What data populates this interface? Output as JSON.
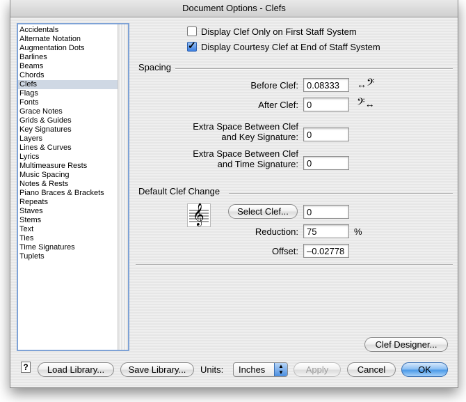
{
  "window": {
    "title": "Document Options - Clefs"
  },
  "sidebar": {
    "items": [
      {
        "label": "Accidentals",
        "selected": false
      },
      {
        "label": "Alternate Notation",
        "selected": false
      },
      {
        "label": "Augmentation Dots",
        "selected": false
      },
      {
        "label": "Barlines",
        "selected": false
      },
      {
        "label": "Beams",
        "selected": false
      },
      {
        "label": "Chords",
        "selected": false
      },
      {
        "label": "Clefs",
        "selected": true
      },
      {
        "label": "Flags",
        "selected": false
      },
      {
        "label": "Fonts",
        "selected": false
      },
      {
        "label": "Grace Notes",
        "selected": false
      },
      {
        "label": "Grids & Guides",
        "selected": false
      },
      {
        "label": "Key Signatures",
        "selected": false
      },
      {
        "label": "Layers",
        "selected": false
      },
      {
        "label": "Lines & Curves",
        "selected": false
      },
      {
        "label": "Lyrics",
        "selected": false
      },
      {
        "label": "Multimeasure Rests",
        "selected": false
      },
      {
        "label": "Music Spacing",
        "selected": false
      },
      {
        "label": "Notes & Rests",
        "selected": false
      },
      {
        "label": "Piano Braces & Brackets",
        "selected": false
      },
      {
        "label": "Repeats",
        "selected": false
      },
      {
        "label": "Staves",
        "selected": false
      },
      {
        "label": "Stems",
        "selected": false
      },
      {
        "label": "Text",
        "selected": false
      },
      {
        "label": "Ties",
        "selected": false
      },
      {
        "label": "Time Signatures",
        "selected": false
      },
      {
        "label": "Tuplets",
        "selected": false
      }
    ]
  },
  "options": {
    "clef_first_only": {
      "label": "Display Clef Only on First Staff System",
      "checked": false
    },
    "courtesy_clef": {
      "label": "Display Courtesy Clef at End of Staff System",
      "checked": true
    }
  },
  "spacing": {
    "heading": "Spacing",
    "before_clef_label": "Before Clef:",
    "before_clef_value": "0.08333",
    "after_clef_label": "After Clef:",
    "after_clef_value": "0",
    "key_sig_label_1": "Extra Space Between Clef",
    "key_sig_label_2": "and Key Signature:",
    "key_sig_value": "0",
    "time_sig_label_1": "Extra Space Between Clef",
    "time_sig_label_2": "and Time Signature:",
    "time_sig_value": "0"
  },
  "default_clef": {
    "heading": "Default Clef Change",
    "select_clef_label": "Select Clef...",
    "clef_value": "0",
    "reduction_label": "Reduction:",
    "reduction_value": "75",
    "reduction_unit": "%",
    "offset_label": "Offset:",
    "offset_value": "–0.02778"
  },
  "buttons": {
    "clef_designer": "Clef Designer...",
    "help": "?",
    "load_library": "Load Library...",
    "save_library": "Save Library...",
    "units_label": "Units:",
    "units_value": "Inches",
    "apply": "Apply",
    "cancel": "Cancel",
    "ok": "OK"
  },
  "icons": {
    "bass_clef_glyph": "𝄢",
    "treble_clef_glyph": "𝄞",
    "arrow_glyph": "↔"
  }
}
